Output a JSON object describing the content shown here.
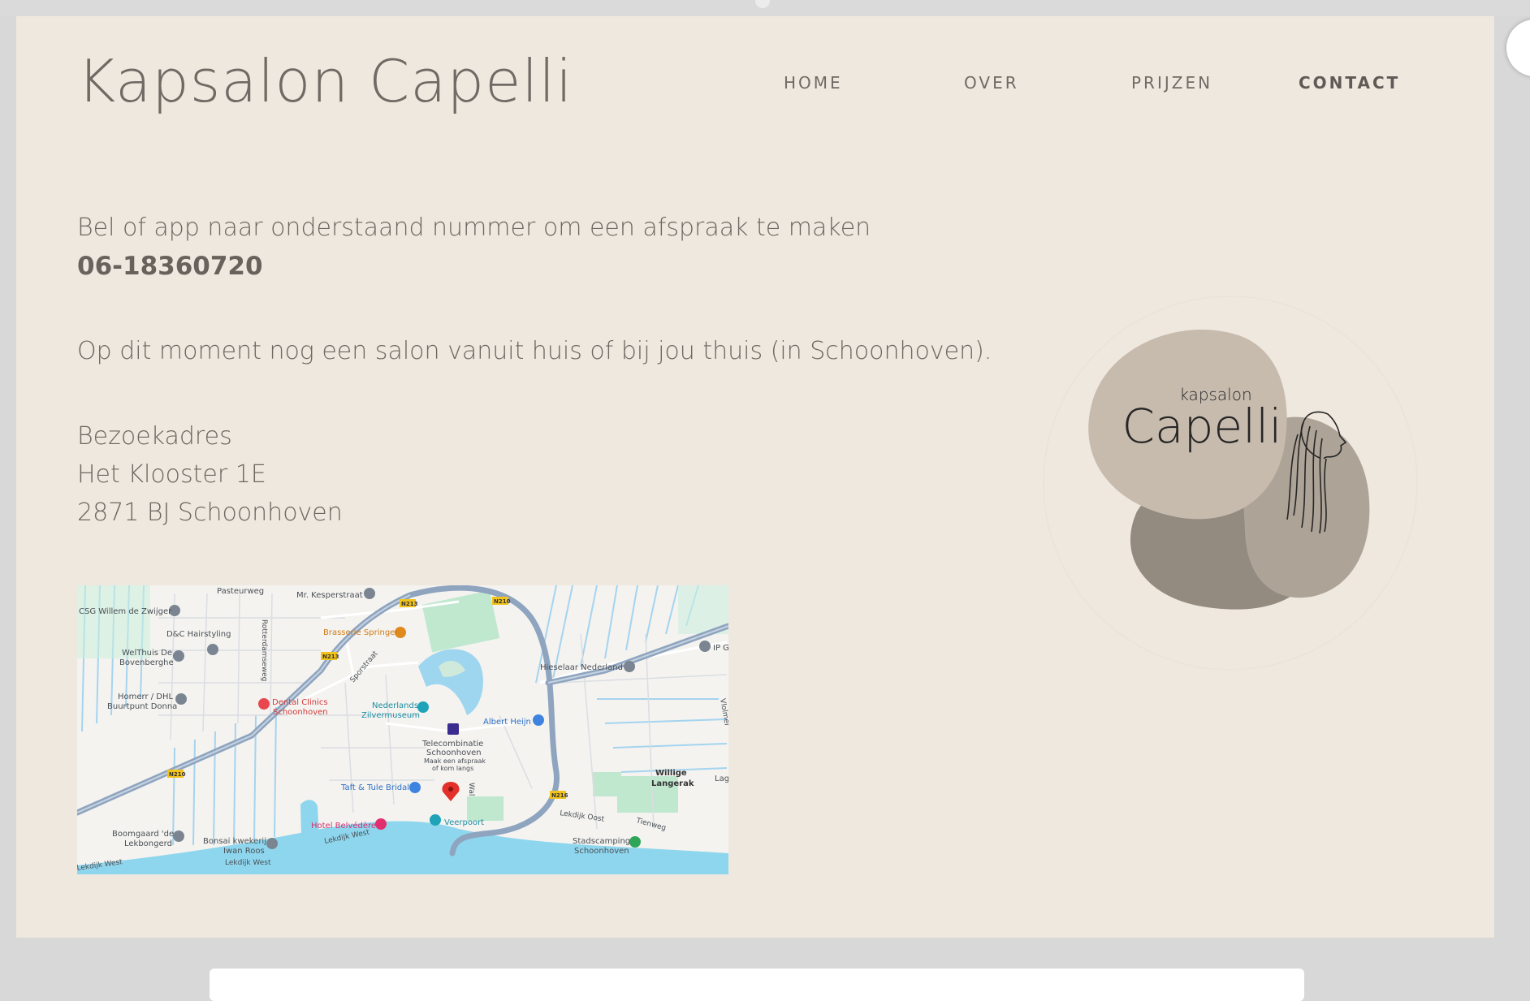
{
  "site": {
    "brand": "Kapsalon Capelli"
  },
  "nav": {
    "items": [
      {
        "label": "HOME",
        "active": false
      },
      {
        "label": "OVER",
        "active": false
      },
      {
        "label": "PRIJZEN",
        "active": false
      },
      {
        "label": "CONTACT",
        "active": true
      }
    ]
  },
  "contact": {
    "intro": "Bel of app naar onderstaand nummer om een afspraak te maken",
    "phone": "06-18360720",
    "note": "Op dit moment nog een salon vanuit huis of bij jou thuis (in Schoonhoven).",
    "address_heading": "Bezoekadres",
    "address_line1": "Het Klooster 1E",
    "address_line2": "2871 BJ Schoonhoven"
  },
  "logo": {
    "small": "kapsalon",
    "large": "Capelli"
  },
  "map": {
    "labels": [
      "Pasteurweg",
      "Mr. Kesperstraat",
      "CSG Willem de Zwijger",
      "D&C Hairstyling",
      "WelThuis De",
      "Bovenberghe",
      "Homerr / DHL",
      "Buurtpunt Donna",
      "Dental Clinics",
      "Schoonhoven",
      "Brasserie Springer",
      "Nederlands",
      "Zilvermuseum",
      "Albert Heijn",
      "Telecombinatie",
      "Schoonhoven",
      "Maak een afspraak",
      "of kom langs",
      "Taft & Tule Bridal",
      "Hotel Belvédère",
      "Veerpoort",
      "Boomgaard 'de",
      "Lekbongerd",
      "Bonsai kwekerij",
      "Iwan Roos",
      "Lekdijk West",
      "Lekdijk West",
      "Lekdijk Oost",
      "Tienweg",
      "Willige",
      "Langerak",
      "Stadscamping",
      "Schoonhoven",
      "Hieselaar Nederland",
      "Rotterdamseweg",
      "Sporstraat",
      "Wal",
      "Lag",
      "IP G",
      "Vlolmer",
      "N213",
      "N210",
      "N213",
      "N210",
      "N216"
    ]
  }
}
